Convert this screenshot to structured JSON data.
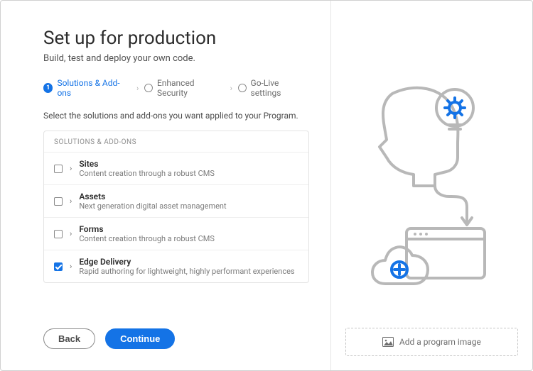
{
  "title": "Set up for production",
  "subtitle": "Build, test and deploy your own code.",
  "breadcrumb": {
    "step1": {
      "num": "1",
      "label": "Solutions & Add-ons"
    },
    "step2": {
      "label": "Enhanced Security"
    },
    "step3": {
      "label": "Go-Live settings"
    }
  },
  "instructions": "Select the solutions and add-ons you want applied to your Program.",
  "solutions_header": "SOLUTIONS & ADD-ONS",
  "solutions": {
    "0": {
      "title": "Sites",
      "desc": "Content creation through a robust CMS",
      "checked": false
    },
    "1": {
      "title": "Assets",
      "desc": "Next generation digital asset management",
      "checked": false
    },
    "2": {
      "title": "Forms",
      "desc": "Content creation through a robust CMS",
      "checked": false
    },
    "3": {
      "title": "Edge Delivery",
      "desc": "Rapid authoring for lightweight, highly performant experiences",
      "checked": true
    }
  },
  "buttons": {
    "back": "Back",
    "continue": "Continue"
  },
  "add_image": "Add a program image",
  "colors": {
    "accent": "#1473e6"
  }
}
